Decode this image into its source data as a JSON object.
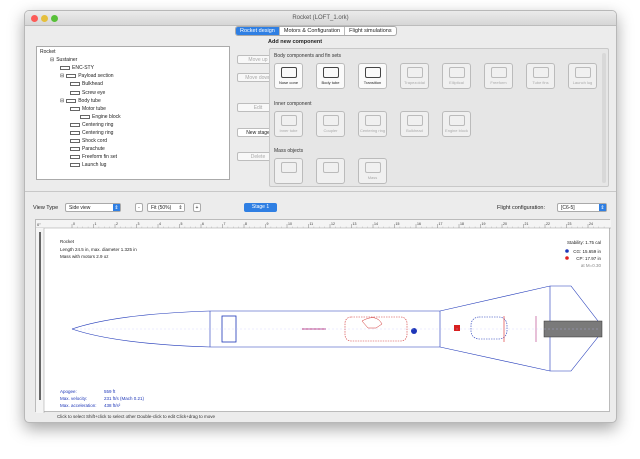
{
  "window": {
    "title": "Rocket (LOFT_1.ork)"
  },
  "tabs": [
    {
      "label": "Rocket design",
      "active": true
    },
    {
      "label": "Motors & Configuration",
      "active": false
    },
    {
      "label": "Flight simulations",
      "active": false
    }
  ],
  "tree": {
    "items": [
      {
        "label": "Rocket",
        "level": 0
      },
      {
        "label": "Sustainer",
        "level": 1
      },
      {
        "label": "ENC-STY",
        "level": 2
      },
      {
        "label": "Payload section",
        "level": 2
      },
      {
        "label": "Bulkhead",
        "level": 3
      },
      {
        "label": "Screw eye",
        "level": 3
      },
      {
        "label": "Body tube",
        "level": 2
      },
      {
        "label": "Motor tube",
        "level": 3
      },
      {
        "label": "Engine block",
        "level": 4
      },
      {
        "label": "Centering ring",
        "level": 3
      },
      {
        "label": "Centering ring",
        "level": 3
      },
      {
        "label": "Shock cord",
        "level": 3
      },
      {
        "label": "Parachute",
        "level": 3
      },
      {
        "label": "Freeform fin set",
        "level": 3
      },
      {
        "label": "Launch lug",
        "level": 3
      }
    ]
  },
  "buttons": {
    "move_up": "Move up",
    "move_down": "Move down",
    "edit": "Edit",
    "new_stage": "New stage",
    "delete": "Delete"
  },
  "add_component": {
    "title": "Add new component",
    "body_header": "Body components and fin sets",
    "body": [
      "Nose cone",
      "Body tube",
      "Transition",
      "Trapezoidal",
      "Elliptical",
      "Freeform",
      "Tube fins",
      "Launch lug"
    ],
    "inner_header": "Inner component",
    "inner": [
      "Inner tube",
      "Coupler",
      "Centering ring",
      "Bulkhead",
      "Engine block"
    ],
    "mass_header": "Mass objects",
    "mass": [
      "",
      "",
      "Mass"
    ]
  },
  "toolbar": {
    "view_type_label": "View Type",
    "view_type_value": "Side view",
    "zoom_value": "Fit (50%)",
    "stage_button": "Stage 1",
    "flight_config_label": "Flight configuration:",
    "flight_config_value": "[C6-5]"
  },
  "canvas": {
    "ruler_corner": "0\"",
    "ruler_ticks": [
      "0",
      "1",
      "2",
      "3",
      "4",
      "5",
      "6",
      "7",
      "8",
      "9",
      "10",
      "11",
      "12",
      "13",
      "14",
      "15",
      "16",
      "17",
      "18",
      "19",
      "20",
      "21",
      "22",
      "23",
      "24",
      "25"
    ],
    "rocket_name": "Rocket",
    "length_line": "Length 24.5 in, max. diameter 1.325 in",
    "mass_line": "Mass with motors 2.9 oz",
    "stability": "Stability: 1.75 cal",
    "cg": "CG: 15.659 in",
    "cp": "CP: 17.97 in",
    "mach": "at M=0.30",
    "apogee_label": "Apogee:",
    "apogee_value": "559 ft",
    "velocity_label": "Max. velocity:",
    "velocity_value": "231 ft/s  (Mach 0.21)",
    "accel_label": "Max. acceleration:",
    "accel_value": "438 ft/s²"
  },
  "status": {
    "text": "Click to select    Shift+click to select other    Double-click to edit    Click+drag to move"
  },
  "colors": {
    "accent": "#2f7fe3",
    "close": "#fc5b57",
    "minimize": "#e5bf3c",
    "zoom": "#57c038",
    "outline": "#1d36b8",
    "cg": "#1d36b8",
    "cp": "#e02020"
  }
}
